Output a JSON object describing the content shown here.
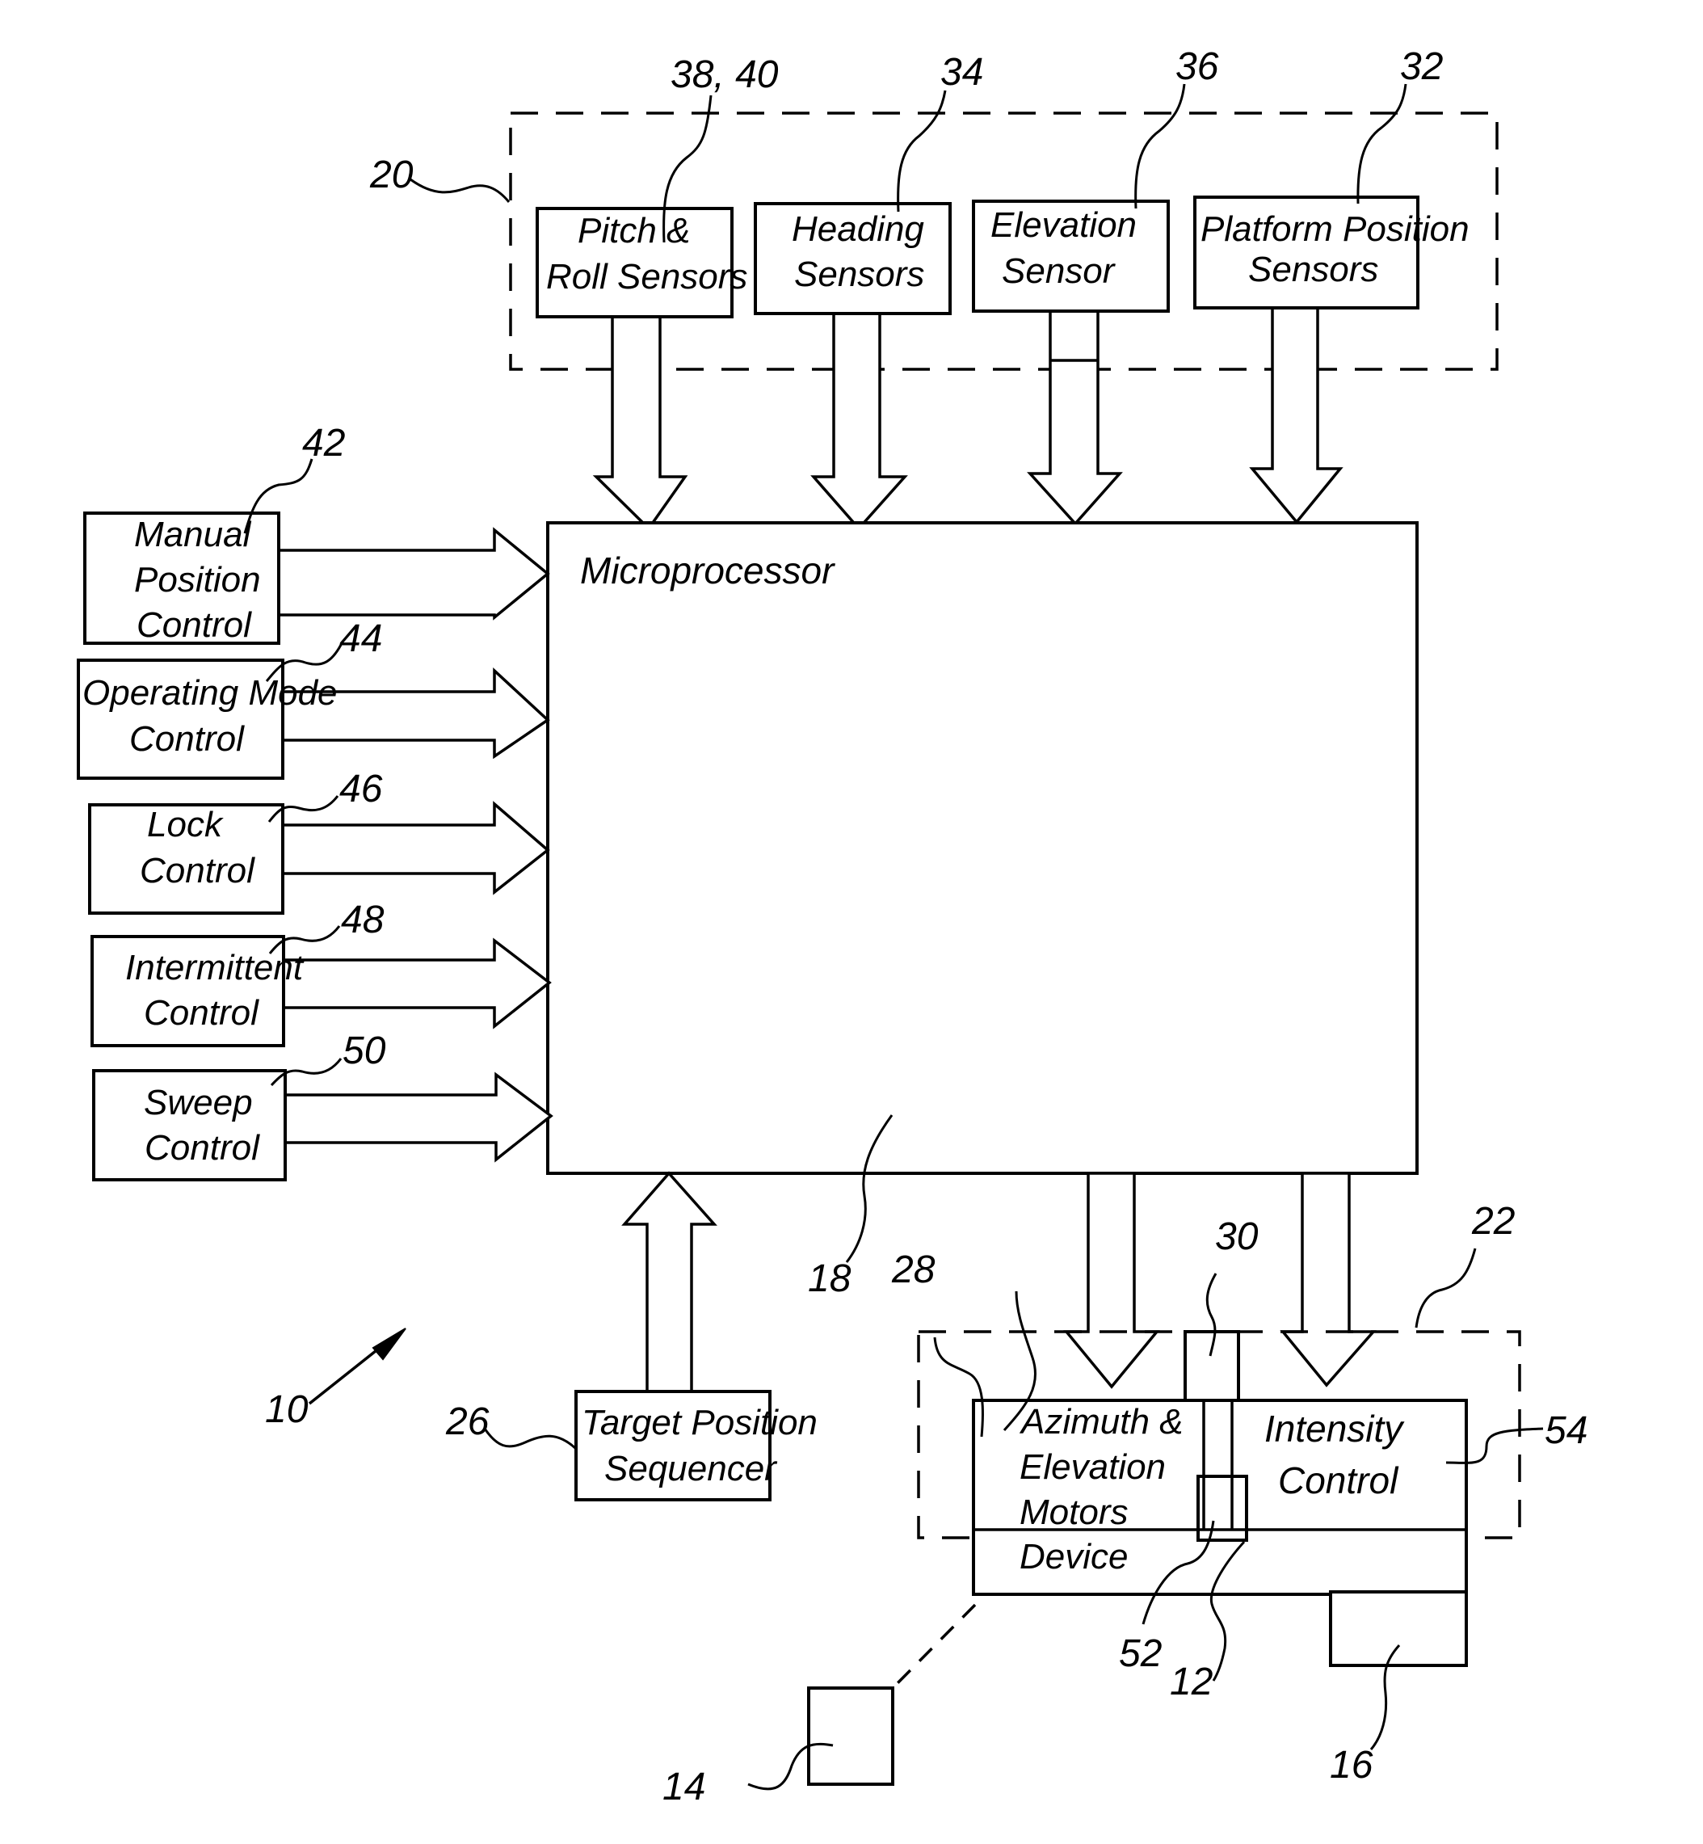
{
  "figure": {
    "system_ref": "10",
    "sensor_group": {
      "ref": "20",
      "sensors": [
        {
          "ref": "38, 40",
          "line1": "Pitch &",
          "line2": "Roll Sensors"
        },
        {
          "ref": "34",
          "line1": "Heading",
          "line2": "Sensors"
        },
        {
          "ref": "36",
          "line1": "Elevation",
          "line2": "Sensor"
        },
        {
          "ref": "32",
          "line1": "Platform Position",
          "line2": "Sensors"
        }
      ]
    },
    "controls": [
      {
        "ref": "42",
        "lines": [
          "Manual",
          "Position",
          "Control"
        ]
      },
      {
        "ref": "44",
        "lines": [
          "Operating Mode",
          "Control"
        ]
      },
      {
        "ref": "46",
        "lines": [
          "Lock",
          "Control"
        ]
      },
      {
        "ref": "48",
        "lines": [
          "Intermittent",
          "Control"
        ]
      },
      {
        "ref": "50",
        "lines": [
          "Sweep",
          "Control"
        ]
      }
    ],
    "microprocessor": {
      "ref": "18",
      "label": "Microprocessor"
    },
    "sequencer": {
      "ref": "26",
      "line1": "Target Position",
      "line2": "Sequencer"
    },
    "device_group": {
      "ref": "22",
      "motors": {
        "ref": "28",
        "lines": [
          "Azimuth &",
          "Elevation",
          "Motors"
        ]
      },
      "device_label": "Device",
      "intensity": {
        "ref": "54",
        "line1": "Intensity",
        "line2": "Control"
      },
      "ref_30": "30",
      "ref_52": "52",
      "ref_12": "12",
      "ref_16": "16",
      "ref_14": "14"
    }
  }
}
